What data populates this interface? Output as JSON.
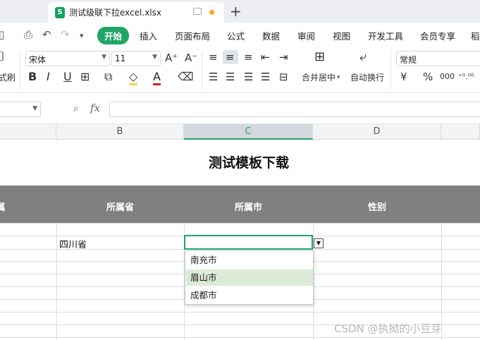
{
  "tab": {
    "logo": "S",
    "title": "测试级联下拉excel.xlsx",
    "new_tab": "+"
  },
  "menu": {
    "items": [
      "开始",
      "插入",
      "页面布局",
      "公式",
      "数据",
      "审阅",
      "视图",
      "开发工具",
      "会员专享",
      "稻"
    ],
    "active_index": 0
  },
  "ribbon": {
    "format_painter": "式刷",
    "font_name": "宋体",
    "font_size": "11",
    "grow_font": "A⁺",
    "shrink_font": "A⁻",
    "bold": "B",
    "italic": "I",
    "underline": "U",
    "merge_center": "合并居中",
    "wrap_text": "自动换行",
    "number_format": "常规",
    "currency": "¥",
    "percent": "%",
    "thousands": "000",
    "decimal": "⁺⁰.⁰⁰"
  },
  "formula_bar": {
    "fx": "fx",
    "value": ""
  },
  "columns": [
    "B",
    "C",
    "D"
  ],
  "selected_column": "C",
  "sheet": {
    "title": "测试模板下载",
    "headers": [
      "所属省",
      "所属市",
      "性别"
    ],
    "cells": {
      "B": "四川省",
      "C": ""
    }
  },
  "dropdown": {
    "options": [
      "南充市",
      "眉山市",
      "成都市"
    ],
    "highlighted_index": 1
  },
  "watermark": "CSDN @执拗的小豆芽",
  "colors": {
    "brand_green": "#1fa464",
    "header_gray": "#808080",
    "highlight": "#dcebd7"
  }
}
